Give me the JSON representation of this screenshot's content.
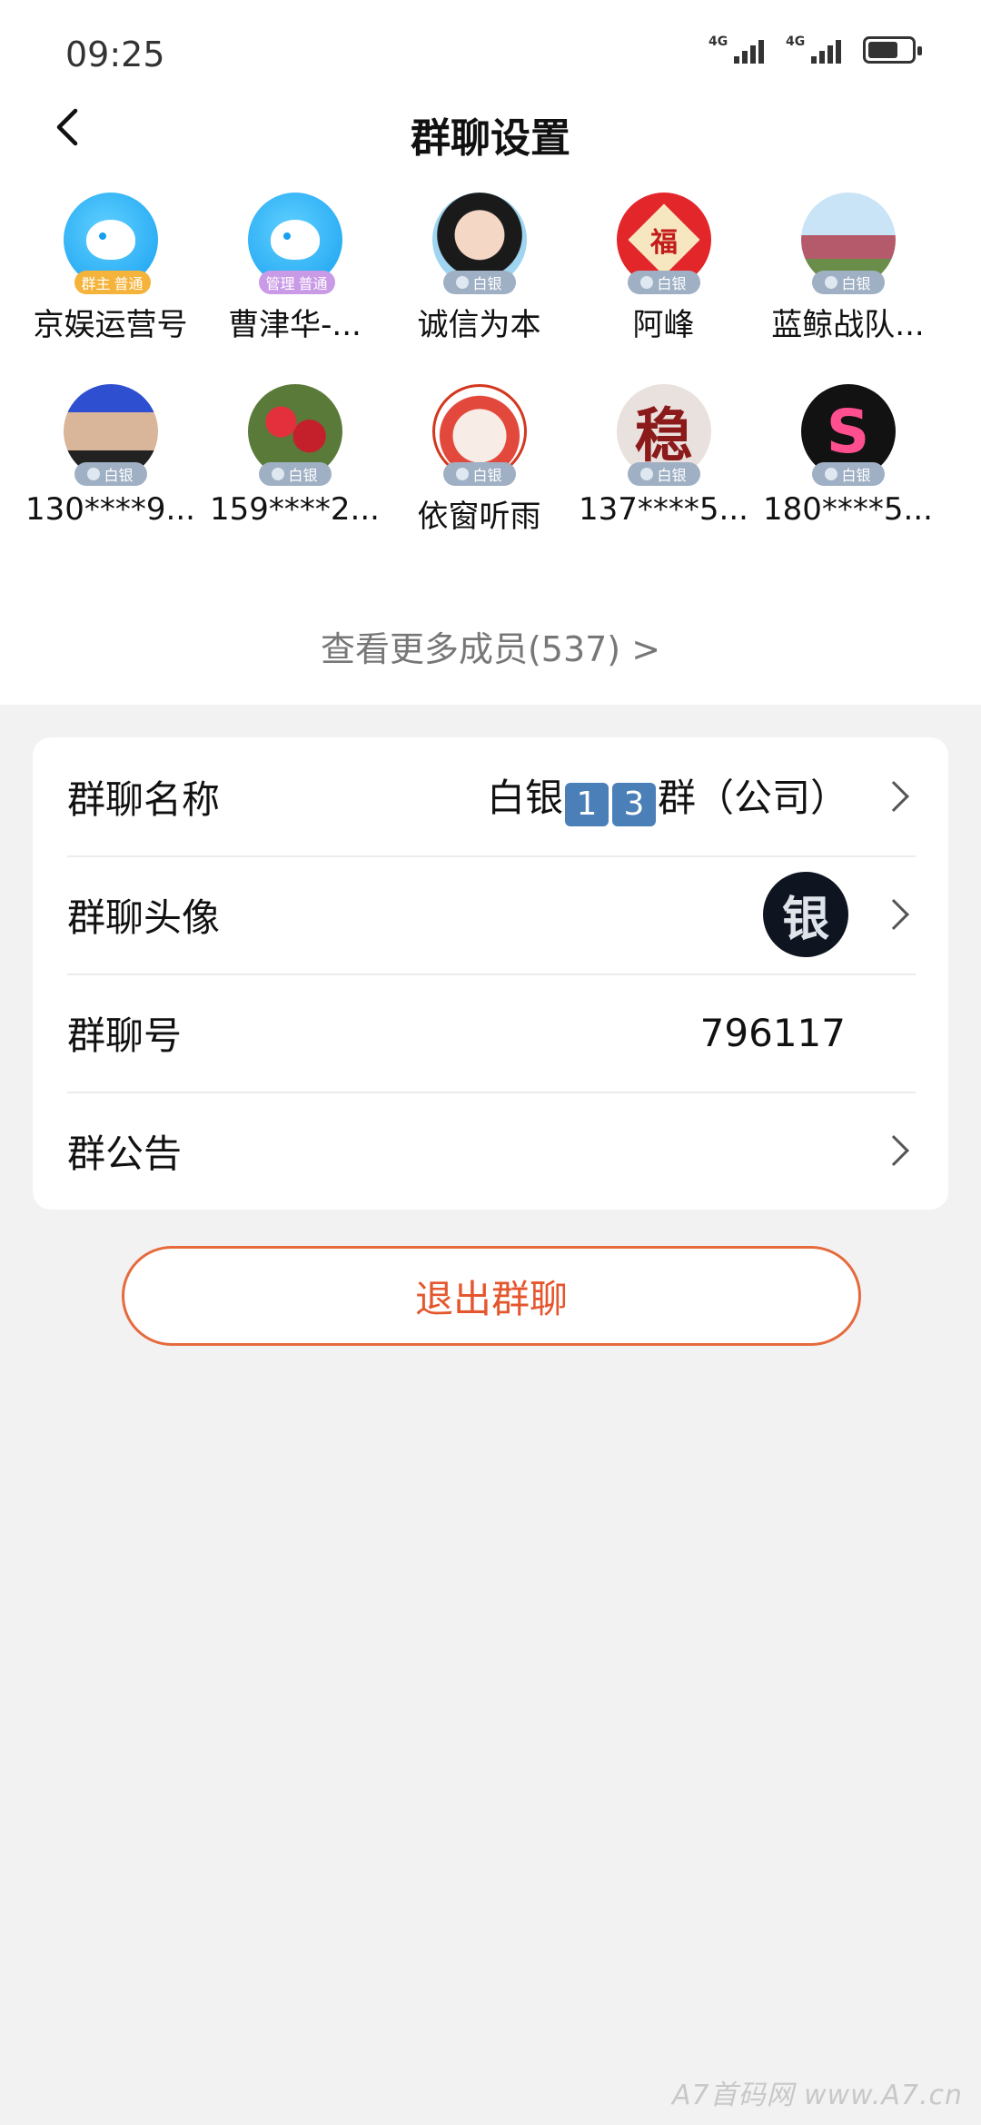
{
  "status_bar": {
    "time": "09:25",
    "network_1": "4G",
    "network_2": "4G"
  },
  "header": {
    "title": "群聊设置"
  },
  "members": [
    {
      "name": "京娱运营号",
      "badge": "普通",
      "role": "群主"
    },
    {
      "name": "曹津华-...",
      "badge": "普通",
      "role": "管理"
    },
    {
      "name": "诚信为本",
      "badge": "白银"
    },
    {
      "name": "阿峰",
      "badge": "白银"
    },
    {
      "name": "蓝鲸战队...",
      "badge": "白银"
    },
    {
      "name": "130****9...",
      "badge": "白银"
    },
    {
      "name": "159****2...",
      "badge": "白银"
    },
    {
      "name": "依窗听雨",
      "badge": "白银"
    },
    {
      "name": "137****5...",
      "badge": "白银"
    },
    {
      "name": "180****5...",
      "badge": "白银"
    }
  ],
  "avatar_glyphs": {
    "fu": "福",
    "wen": "稳",
    "s": "S",
    "group": "银"
  },
  "more_members": "查看更多成员(537)  >",
  "settings": {
    "group_name_label": "群聊名称",
    "group_name_value_prefix": "白银",
    "group_name_digit_1": "1",
    "group_name_digit_2": "3",
    "group_name_value_suffix": "群（公司）",
    "group_avatar_label": "群聊头像",
    "group_id_label": "群聊号",
    "group_id_value": "796117",
    "announcement_label": "群公告"
  },
  "exit_button": "退出群聊",
  "watermark": "A7首码网    www.A7.cn",
  "colors": {
    "accent": "#e4572e",
    "badge_silver": "#9fb0c4"
  }
}
